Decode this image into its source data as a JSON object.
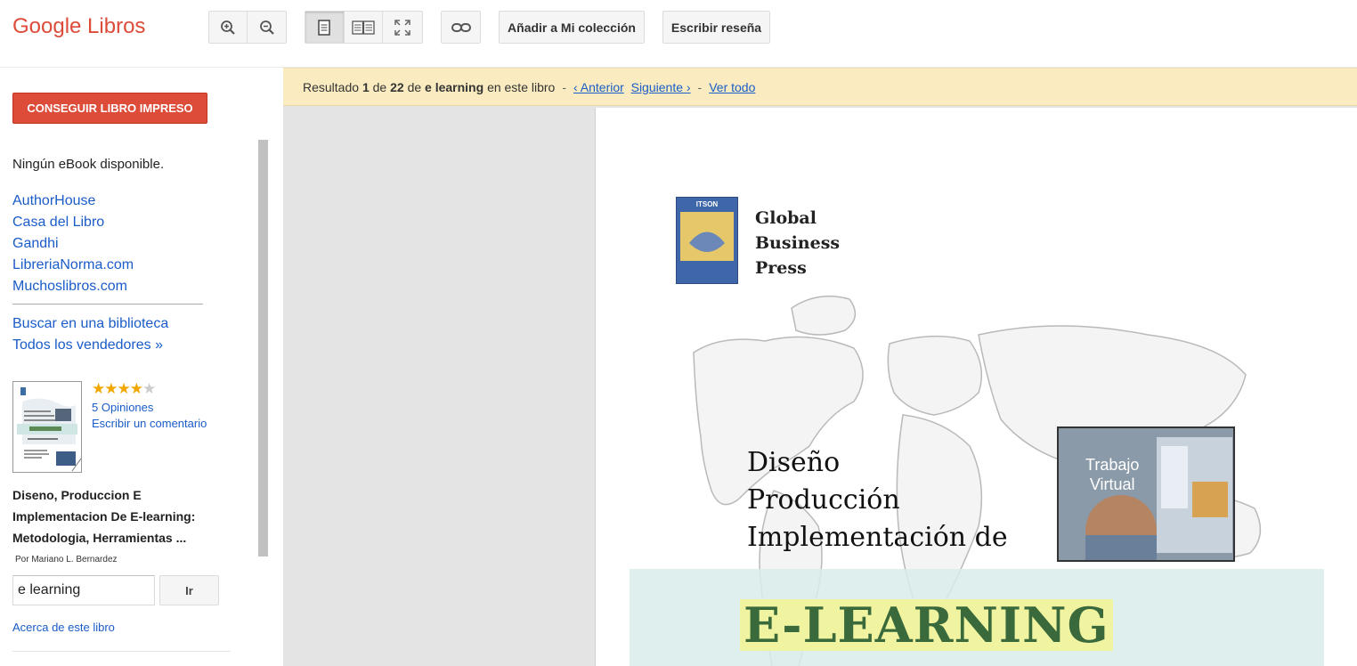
{
  "app": {
    "logo": "Google Libros"
  },
  "toolbar": {
    "zoom_in": "zoom-in",
    "zoom_out": "zoom-out",
    "add_collection": "Añadir a Mi colección",
    "write_review": "Escribir reseña"
  },
  "sidebar": {
    "buy_button": "CONSEGUIR LIBRO IMPRESO",
    "no_ebook": "Ningún eBook disponible.",
    "sellers": [
      "AuthorHouse",
      "Casa del Libro",
      "Gandhi",
      "LibreriaNorma.com",
      "Muchoslibros.com"
    ],
    "library": "Buscar en una biblioteca",
    "all_sellers": "Todos los vendedores »",
    "rating": {
      "stars": 4,
      "max": 5
    },
    "opinions": "5 Opiniones",
    "write_comment": "Escribir un comentario",
    "book_title": "Diseno, Produccion E Implementacion De E-learning: Metodologia, Herramientas ...",
    "author": "Por Mariano L. Bernardez",
    "search_value": "e learning",
    "go_button": "Ir",
    "about": "Acerca de este libro"
  },
  "result": {
    "prefix": "Resultado",
    "current": "1",
    "of": "de",
    "total": "22",
    "de2": "de",
    "query": "e learning",
    "suffix": "en este libro",
    "prev": "‹ Anterior",
    "next": "Siguiente ›",
    "view_all": "Ver todo"
  },
  "page": {
    "publisher": [
      "Global",
      "Business",
      "Press"
    ],
    "logo_text": "ITSON",
    "title_lines": [
      "Diseño",
      "Producción",
      "Implementación de"
    ],
    "inset_label": [
      "Trabajo",
      "Virtual"
    ],
    "big_title": "E-LEARNING"
  },
  "colors": {
    "brand": "#dd4b39",
    "link": "#1a5cc8",
    "result_bar": "#faecc0"
  }
}
